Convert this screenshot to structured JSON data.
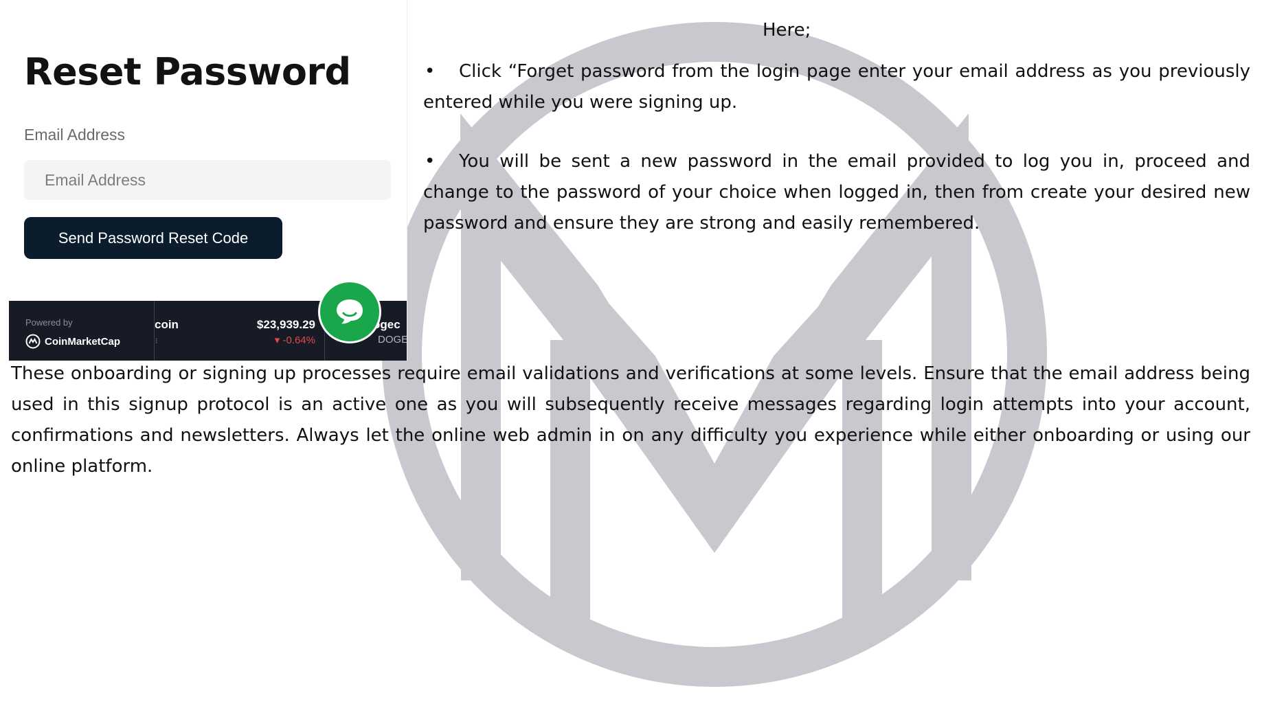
{
  "watermark": {
    "icon": "m-monogram-watermark",
    "color": "#c8c9ce"
  },
  "screenshot": {
    "title": "Reset Password",
    "email_label": "Email Address",
    "email_placeholder": "Email Address",
    "email_value": "",
    "button_label": "Send Password Reset Code",
    "button_color": "#0b1d2c",
    "chat_icon": "chat-bubble-icon",
    "chat_color": "#1aa64a",
    "ticker": {
      "powered_by": "Powered by",
      "brand": "CoinMarketCap",
      "coin_name": "coin",
      "coin_dots": "⁝",
      "price": "$23,939.29",
      "change": "▾ -0.64%",
      "next_coin_name": "ogec",
      "next_coin_symbol": "DOGE",
      "background": "#171b25",
      "negative_color": "#e5484d"
    }
  },
  "document": {
    "intro": "Here;",
    "bullets": [
      {
        "mark": "•",
        "text": "Click “Forget password from the login page enter your email address as you previously entered while you were signing up."
      },
      {
        "mark": "•",
        "text": "You will be sent a new password in the email provided to log you in, proceed and change to the password of your choice when logged in, then from create your desired new password and ensure they are strong and easily remembered."
      }
    ],
    "paragraph": "These onboarding or signing up processes require email validations and verifications at some levels. Ensure that the email address being used in this signup protocol is an active one as you will subsequently receive messages regarding login attempts into your account, confirmations and newsletters. Always let the online web admin in on any difficulty you experience while either onboarding or using our online platform."
  }
}
